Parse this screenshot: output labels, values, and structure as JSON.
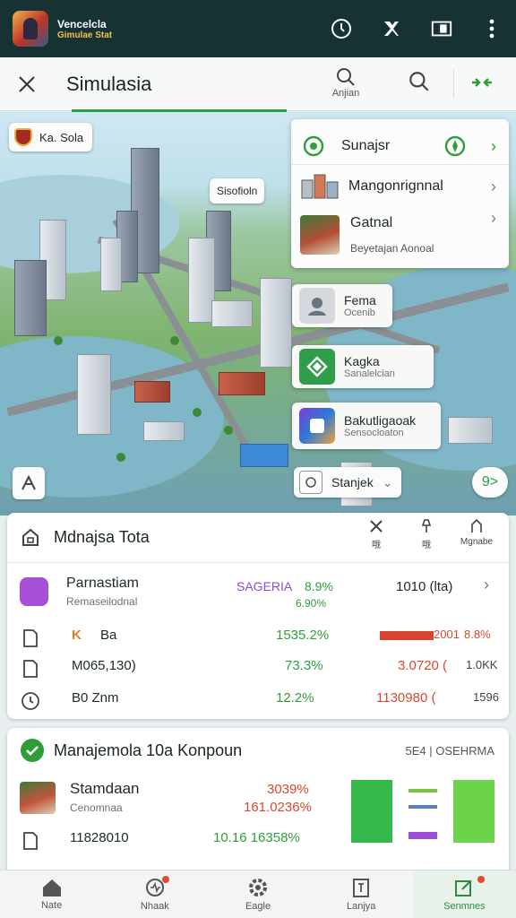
{
  "app": {
    "title": "Vencelcla",
    "subtitle": "Gimulae Stat"
  },
  "toolbar": {
    "title": "Simulasia",
    "search_label": "Anjian"
  },
  "map": {
    "city_chip": "Ka. Sola",
    "bubble": "Sisofioln",
    "panel": {
      "header": "Sunajsr",
      "item1": "Mangonrignnal",
      "item2_title": "Gatnal",
      "item2_sub": "Beyetajan Aonoal"
    },
    "cards": [
      {
        "title": "Fema",
        "sub": "Ocenib"
      },
      {
        "title": "Kagka",
        "sub": "Sanalelcian"
      },
      {
        "title": "Bakutligaoak",
        "sub": "Sensocloaton"
      }
    ],
    "select_label": "Stanjek",
    "expand_label": "9>"
  },
  "stats": {
    "title": "Mdnajsa Tota",
    "tools": [
      "哦",
      "哦",
      "Mgnabe"
    ],
    "rows": [
      {
        "name": "Parnastiam",
        "sub": "Remaseilodnal",
        "c1": "SAGERIA",
        "c2": "8.9%",
        "c2b": "6.90%",
        "c3": "1010 (lta)"
      },
      {
        "name": "Ba",
        "c2": "1535.2%",
        "c3a": "2001",
        "c3b": "8.8%"
      },
      {
        "name": "M065,130)",
        "c2": "73.3%",
        "c3a": "3.0720 (",
        "c3b": "1.0KK"
      },
      {
        "name": "B0 Znm",
        "c2": "12.2%",
        "c3a": "1130980 (",
        "c3b": "1596"
      }
    ]
  },
  "manage": {
    "title": "Manajemola 10a Konpoun",
    "right": "5E4 | OSEHRMA",
    "rows": [
      {
        "name": "Stamdaan",
        "sub": "Cenomnaa",
        "v1": "3039%",
        "v2": "161.0236%"
      },
      {
        "name": "11828010",
        "v1": "10.16 16358%"
      }
    ]
  },
  "nav": [
    {
      "label": "Nate"
    },
    {
      "label": "Nhaak"
    },
    {
      "label": "Eagle"
    },
    {
      "label": "Lanjya"
    },
    {
      "label": "Senmnes"
    }
  ],
  "colors": {
    "accent": "#2e9d3a",
    "appbar": "#163233",
    "negative": "#d9482e"
  }
}
